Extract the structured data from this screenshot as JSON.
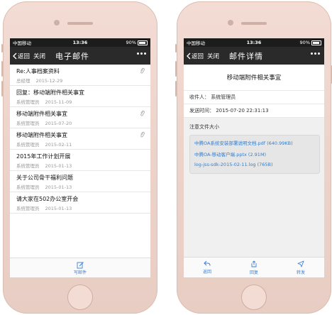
{
  "status_bar": {
    "carrier": "中国移动",
    "time": "13:36",
    "battery": "90%"
  },
  "left_screen": {
    "nav": {
      "back_label": "返回",
      "close_label": "关闭",
      "title": "电子邮件"
    },
    "mails": [
      {
        "subject": "Re:人事档案资料",
        "sender": "总经理",
        "date": "2015-12-29",
        "attachment": true
      },
      {
        "subject": "回复：移动端附件相关事宜",
        "sender": "系统管理员",
        "date": "2015-11-09",
        "attachment": false
      },
      {
        "subject": "移动端附件相关事宜",
        "sender": "系统管理员",
        "date": "2015-07-20",
        "attachment": true
      },
      {
        "subject": "移动端附件相关事宜",
        "sender": "系统管理员",
        "date": "2015-02-11",
        "attachment": true
      },
      {
        "subject": "2015年工作计划开展",
        "sender": "系统管理员",
        "date": "2015-01-13",
        "attachment": false
      },
      {
        "subject": "关于公司骨干福利问题",
        "sender": "系统管理员",
        "date": "2015-01-13",
        "attachment": false
      },
      {
        "subject": "请大家在502办公室开会",
        "sender": "系统管理员",
        "date": "2015-01-13",
        "attachment": false
      }
    ],
    "compose_label": "写邮件"
  },
  "right_screen": {
    "nav": {
      "back_label": "返回",
      "close_label": "关闭",
      "title": "邮件详情"
    },
    "mail_title": "移动端附件相关事宜",
    "recipient": "收件人：  系统管理员",
    "sent_time": "发送时间：  2015-07-20 22:31:13",
    "attachments_label": "注意文件大小",
    "attachments": [
      "中腾OA系统安装部署说明文档.pdf (640.99KB)",
      "中腾OA-移动客户端.pptx (2.91M)",
      "log-jss-sdk-2015-02-11.log (765B)"
    ],
    "actions": {
      "back": "返回",
      "reply": "回复",
      "forward": "转发"
    }
  },
  "colors": {
    "accent": "#3a7fd5",
    "nav_bg": "#2a2a2a",
    "phone_body": "#efd6cd"
  }
}
